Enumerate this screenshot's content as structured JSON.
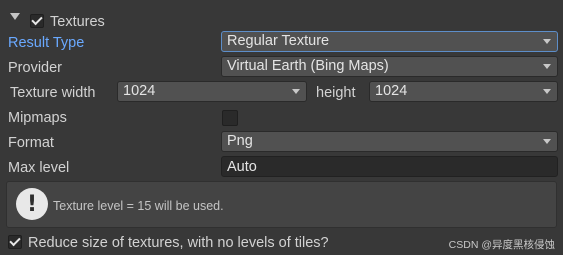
{
  "section": {
    "title": "Textures",
    "enabled": true
  },
  "fields": {
    "result_type": {
      "label": "Result Type",
      "value": "Regular Texture"
    },
    "provider": {
      "label": "Provider",
      "value": "Virtual Earth (Bing Maps)"
    },
    "texture_width": {
      "label": "Texture width",
      "value": "1024"
    },
    "height": {
      "label": "height",
      "value": "1024"
    },
    "mipmaps": {
      "label": "Mipmaps",
      "checked": false
    },
    "format": {
      "label": "Format",
      "value": "Png"
    },
    "max_level": {
      "label": "Max level",
      "value": "Auto"
    }
  },
  "help": {
    "icon": "exclamation-icon",
    "message": "Texture level = 15 will be used."
  },
  "reduce_size": {
    "label": "Reduce size of textures, with no levels of tiles?",
    "checked": true
  },
  "watermark": "CSDN @异度黑核侵蚀",
  "colors": {
    "background": "#383838",
    "active_label": "#6aa9ff",
    "focus_border": "#5d8ec9"
  }
}
